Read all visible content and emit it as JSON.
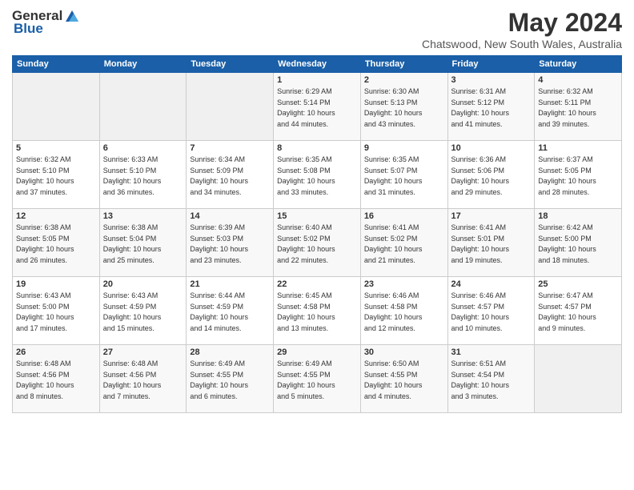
{
  "logo": {
    "general": "General",
    "blue": "Blue"
  },
  "header": {
    "month_year": "May 2024",
    "location": "Chatswood, New South Wales, Australia"
  },
  "days_of_week": [
    "Sunday",
    "Monday",
    "Tuesday",
    "Wednesday",
    "Thursday",
    "Friday",
    "Saturday"
  ],
  "weeks": [
    [
      {
        "day": "",
        "info": ""
      },
      {
        "day": "",
        "info": ""
      },
      {
        "day": "",
        "info": ""
      },
      {
        "day": "1",
        "sunrise": "6:29 AM",
        "sunset": "5:14 PM",
        "daylight": "10 hours and 44 minutes."
      },
      {
        "day": "2",
        "sunrise": "6:30 AM",
        "sunset": "5:13 PM",
        "daylight": "10 hours and 43 minutes."
      },
      {
        "day": "3",
        "sunrise": "6:31 AM",
        "sunset": "5:12 PM",
        "daylight": "10 hours and 41 minutes."
      },
      {
        "day": "4",
        "sunrise": "6:32 AM",
        "sunset": "5:11 PM",
        "daylight": "10 hours and 39 minutes."
      }
    ],
    [
      {
        "day": "5",
        "sunrise": "6:32 AM",
        "sunset": "5:10 PM",
        "daylight": "10 hours and 37 minutes."
      },
      {
        "day": "6",
        "sunrise": "6:33 AM",
        "sunset": "5:10 PM",
        "daylight": "10 hours and 36 minutes."
      },
      {
        "day": "7",
        "sunrise": "6:34 AM",
        "sunset": "5:09 PM",
        "daylight": "10 hours and 34 minutes."
      },
      {
        "day": "8",
        "sunrise": "6:35 AM",
        "sunset": "5:08 PM",
        "daylight": "10 hours and 33 minutes."
      },
      {
        "day": "9",
        "sunrise": "6:35 AM",
        "sunset": "5:07 PM",
        "daylight": "10 hours and 31 minutes."
      },
      {
        "day": "10",
        "sunrise": "6:36 AM",
        "sunset": "5:06 PM",
        "daylight": "10 hours and 29 minutes."
      },
      {
        "day": "11",
        "sunrise": "6:37 AM",
        "sunset": "5:05 PM",
        "daylight": "10 hours and 28 minutes."
      }
    ],
    [
      {
        "day": "12",
        "sunrise": "6:38 AM",
        "sunset": "5:05 PM",
        "daylight": "10 hours and 26 minutes."
      },
      {
        "day": "13",
        "sunrise": "6:38 AM",
        "sunset": "5:04 PM",
        "daylight": "10 hours and 25 minutes."
      },
      {
        "day": "14",
        "sunrise": "6:39 AM",
        "sunset": "5:03 PM",
        "daylight": "10 hours and 23 minutes."
      },
      {
        "day": "15",
        "sunrise": "6:40 AM",
        "sunset": "5:02 PM",
        "daylight": "10 hours and 22 minutes."
      },
      {
        "day": "16",
        "sunrise": "6:41 AM",
        "sunset": "5:02 PM",
        "daylight": "10 hours and 21 minutes."
      },
      {
        "day": "17",
        "sunrise": "6:41 AM",
        "sunset": "5:01 PM",
        "daylight": "10 hours and 19 minutes."
      },
      {
        "day": "18",
        "sunrise": "6:42 AM",
        "sunset": "5:00 PM",
        "daylight": "10 hours and 18 minutes."
      }
    ],
    [
      {
        "day": "19",
        "sunrise": "6:43 AM",
        "sunset": "5:00 PM",
        "daylight": "10 hours and 17 minutes."
      },
      {
        "day": "20",
        "sunrise": "6:43 AM",
        "sunset": "4:59 PM",
        "daylight": "10 hours and 15 minutes."
      },
      {
        "day": "21",
        "sunrise": "6:44 AM",
        "sunset": "4:59 PM",
        "daylight": "10 hours and 14 minutes."
      },
      {
        "day": "22",
        "sunrise": "6:45 AM",
        "sunset": "4:58 PM",
        "daylight": "10 hours and 13 minutes."
      },
      {
        "day": "23",
        "sunrise": "6:46 AM",
        "sunset": "4:58 PM",
        "daylight": "10 hours and 12 minutes."
      },
      {
        "day": "24",
        "sunrise": "6:46 AM",
        "sunset": "4:57 PM",
        "daylight": "10 hours and 10 minutes."
      },
      {
        "day": "25",
        "sunrise": "6:47 AM",
        "sunset": "4:57 PM",
        "daylight": "10 hours and 9 minutes."
      }
    ],
    [
      {
        "day": "26",
        "sunrise": "6:48 AM",
        "sunset": "4:56 PM",
        "daylight": "10 hours and 8 minutes."
      },
      {
        "day": "27",
        "sunrise": "6:48 AM",
        "sunset": "4:56 PM",
        "daylight": "10 hours and 7 minutes."
      },
      {
        "day": "28",
        "sunrise": "6:49 AM",
        "sunset": "4:55 PM",
        "daylight": "10 hours and 6 minutes."
      },
      {
        "day": "29",
        "sunrise": "6:49 AM",
        "sunset": "4:55 PM",
        "daylight": "10 hours and 5 minutes."
      },
      {
        "day": "30",
        "sunrise": "6:50 AM",
        "sunset": "4:55 PM",
        "daylight": "10 hours and 4 minutes."
      },
      {
        "day": "31",
        "sunrise": "6:51 AM",
        "sunset": "4:54 PM",
        "daylight": "10 hours and 3 minutes."
      },
      {
        "day": "",
        "info": ""
      }
    ]
  ],
  "labels": {
    "sunrise_prefix": "Sunrise: ",
    "sunset_prefix": "Sunset: ",
    "daylight_prefix": "Daylight: "
  }
}
